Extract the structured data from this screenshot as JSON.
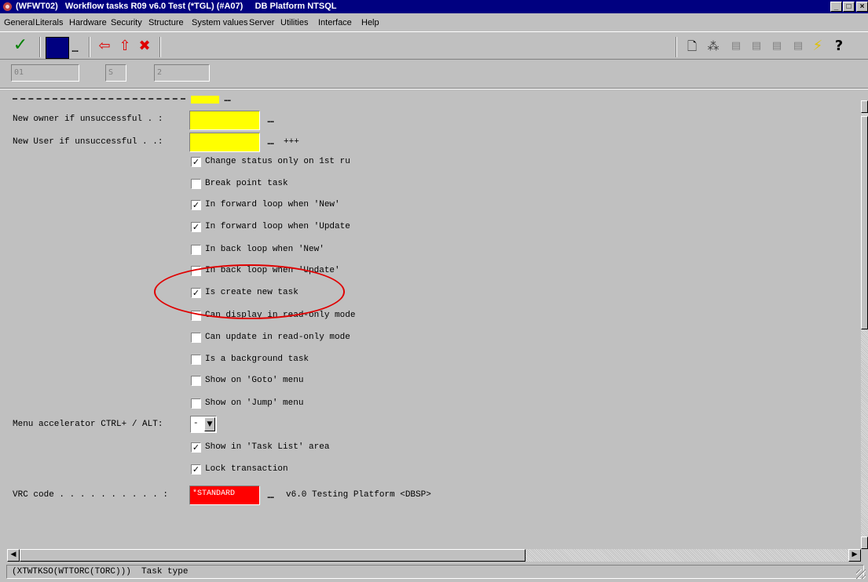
{
  "window": {
    "title": "(WFWT02)   Workflow tasks R09 v6.0 Test (*TGL) (#A07)     DB Platform NTSQL",
    "min_label": "_",
    "max_label": "□",
    "close_label": "×"
  },
  "menu": {
    "items": [
      "General",
      "Literals",
      "Hardware",
      "Security",
      "Structure",
      "System values",
      "Server",
      "Utilities",
      "Interface",
      "Help"
    ]
  },
  "toolbar": {
    "dots_label": "....",
    "left_icons": [
      "check-icon",
      "color-box-icon",
      "back-arrow-icon",
      "up-arrow-icon",
      "delete-x-icon"
    ],
    "right_icons": [
      "new-doc-icon",
      "tree-icon",
      "field-icon-1",
      "field-icon-2",
      "field-icon-3",
      "field-icon-4",
      "lightning-icon",
      "help-icon"
    ],
    "accent_blue": "#000080"
  },
  "selectors": {
    "field1": "01",
    "field2": "S",
    "field3": "2"
  },
  "form": {
    "owner_label": "New owner if unsuccessful . :",
    "user_label": "New User if unsuccessful . .:",
    "user_suffix": "+++",
    "dots": "....",
    "checkboxes": [
      {
        "label": "Change status only on 1st ru",
        "checked": true
      },
      {
        "label": "Break point task",
        "checked": false
      },
      {
        "label": "In forward loop when 'New'",
        "checked": true
      },
      {
        "label": "In forward loop when 'Update",
        "checked": true
      },
      {
        "label": "In back loop when 'New'",
        "checked": false
      },
      {
        "label": "In back loop when 'Update'",
        "checked": false
      },
      {
        "label": "Is create new task",
        "checked": true
      },
      {
        "label": "Can display in read-only mode",
        "checked": false
      },
      {
        "label": "Can update in read-only mode",
        "checked": false
      },
      {
        "label": "Is a background task",
        "checked": false
      },
      {
        "label": "Show on 'Goto' menu",
        "checked": false
      },
      {
        "label": "Show on 'Jump' menu",
        "checked": false
      }
    ],
    "accel_label": "Menu accelerator CTRL+ / ALT:",
    "accel_value": "-",
    "checkboxes2": [
      {
        "label": "Show in 'Task List' area",
        "checked": true
      },
      {
        "label": "Lock transaction",
        "checked": true
      }
    ],
    "vrc_label": "VRC code . . . . . . . . . . :",
    "vrc_value": "*STANDARD",
    "vrc_desc": "v6.0 Testing Platform <DBSP>",
    "field_color": "#ffff00",
    "vrc_color": "#ff0000"
  },
  "status": {
    "text": "(XTWTKSO(WTTORC(TORC)))  Task type"
  },
  "annotation": {
    "circle_color": "#e00000"
  }
}
